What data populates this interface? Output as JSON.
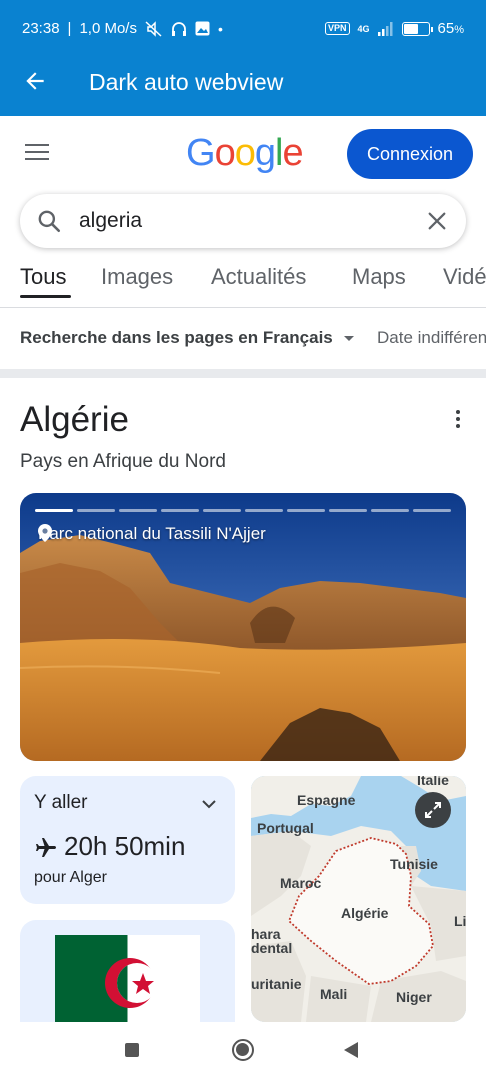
{
  "status_bar": {
    "time": "23:38",
    "net_speed": "1,0 Mo/s",
    "network": "4G",
    "vpn": "VPN",
    "battery": "65",
    "battery_unit": "%",
    "battery_level": 0.65,
    "icons": [
      "mute-icon",
      "headphones-icon",
      "gallery-icon",
      "dot-icon",
      "vpn-icon",
      "signal-icon",
      "battery-icon"
    ]
  },
  "app_bar": {
    "title": "Dark auto webview",
    "back_icon": "arrow-back-icon"
  },
  "google_header": {
    "logo_letters": [
      "G",
      "o",
      "o",
      "g",
      "l",
      "e"
    ],
    "logo_colors": [
      "#4285F4",
      "#EA4335",
      "#FBBC05",
      "#4285F4",
      "#34A853",
      "#EA4335"
    ],
    "login_label": "Connexion",
    "login_color": "#0b57d0"
  },
  "search": {
    "query": "algeria"
  },
  "tabs": {
    "items": [
      "Tous",
      "Images",
      "Actualités",
      "Maps",
      "Vidéos"
    ],
    "active": "Tous"
  },
  "filters": {
    "language": "Recherche dans les pages en Français",
    "date": "Date indifférente"
  },
  "knowledge_panel": {
    "title": "Algérie",
    "subtitle": "Pays en Afrique du Nord",
    "hero_caption": "Parc national du Tassili N'Ajjer",
    "hero_slides": 10,
    "hero_active_slide": 1,
    "directions": {
      "label": "Y aller",
      "duration": "20h 50min",
      "destination": "pour Alger"
    },
    "map_labels": [
      "Italie",
      "Espagne",
      "Portugal",
      "Tunisie",
      "Maroc",
      "Algérie",
      "Li",
      "hara",
      "dental",
      "uritanie",
      "Mali",
      "Niger"
    ],
    "flag_colors": {
      "green": "#006233",
      "white": "#ffffff",
      "red": "#d21034"
    }
  },
  "nav_bar": {
    "icons": [
      "recents-square-icon",
      "home-circle-icon",
      "back-triangle-icon"
    ]
  }
}
